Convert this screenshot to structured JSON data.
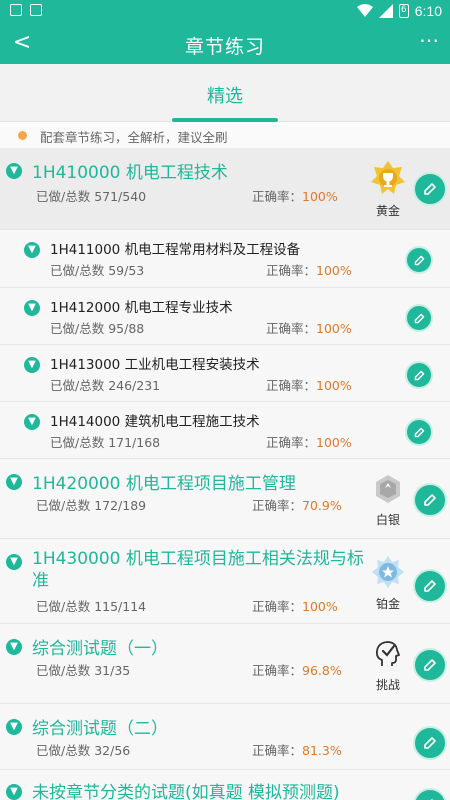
{
  "status": {
    "battery_level": "6",
    "time": "6:10"
  },
  "app_bar": {
    "back": "<",
    "title": "章节练习",
    "more": "⋯"
  },
  "tabs": {
    "active": "精选"
  },
  "tip": "配套章节练习，全解析，建议全刷",
  "labels": {
    "done": "已做/总数",
    "rate": "正确率："
  },
  "chapters": [
    {
      "title": "1H410000 机电工程技术",
      "done": "571/540",
      "rate": "100%",
      "badge": "黄金",
      "badge_icon": "trophy-icon"
    },
    {
      "title": "1H411000 机电工程常用材料及工程设备",
      "done": "59/53",
      "rate": "100%"
    },
    {
      "title": "1H412000 机电工程专业技术",
      "done": "95/88",
      "rate": "100%"
    },
    {
      "title": "1H413000 工业机电工程安装技术",
      "done": "246/231",
      "rate": "100%"
    },
    {
      "title": "1H414000 建筑机电工程施工技术",
      "done": "171/168",
      "rate": "100%"
    },
    {
      "title": "1H420000 机电工程项目施工管理",
      "done": "172/189",
      "rate": "70.9%",
      "badge": "白银",
      "badge_icon": "silver-medal-icon"
    },
    {
      "title": "1H430000 机电工程项目施工相关法规与标准",
      "done": "115/114",
      "rate": "100%",
      "badge": "铂金",
      "badge_icon": "platinum-medal-icon"
    },
    {
      "title": "综合测试题（一）",
      "done": "31/35",
      "rate": "96.8%",
      "badge": "挑战",
      "badge_icon": "challenge-icon"
    },
    {
      "title": "综合测试题（二）",
      "done": "32/56",
      "rate": "81.3%"
    },
    {
      "title": "未按章节分类的试题(如真题 模拟预测题)"
    }
  ],
  "colors": {
    "accent": "#1fb89a",
    "rate": "#e07a2a"
  }
}
